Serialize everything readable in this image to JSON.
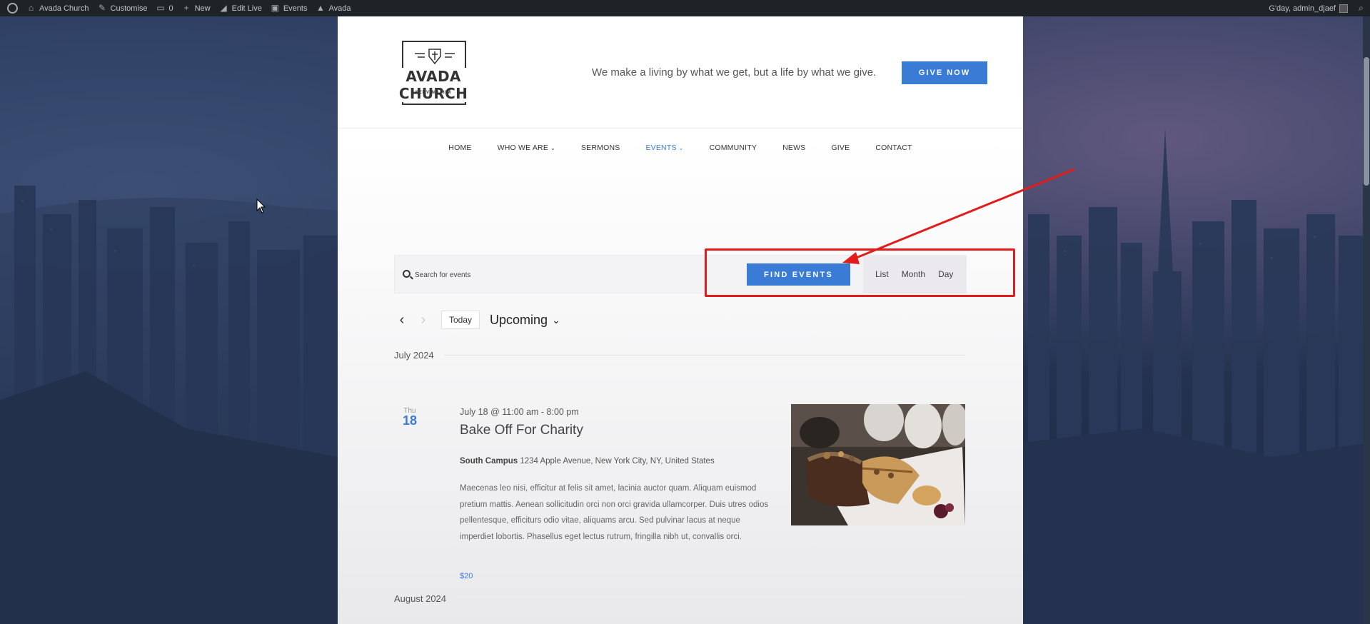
{
  "admin_bar": {
    "site_name": "Avada Church",
    "customise": "Customise",
    "comments_count": "0",
    "new": "New",
    "edit_live": "Edit Live",
    "events": "Events",
    "avada": "Avada",
    "greeting": "G'day, admin_djaef"
  },
  "header": {
    "logo_title": "AVADA CHURCH",
    "logo_subtitle": "SERVING HIM",
    "tagline": "We make a living by what we get, but a life by what we give.",
    "give_button": "GIVE NOW"
  },
  "nav": {
    "items": [
      {
        "label": "HOME"
      },
      {
        "label": "WHO WE ARE"
      },
      {
        "label": "SERMONS"
      },
      {
        "label": "EVENTS"
      },
      {
        "label": "COMMUNITY"
      },
      {
        "label": "NEWS"
      },
      {
        "label": "GIVE"
      },
      {
        "label": "CONTACT"
      }
    ],
    "active": "EVENTS"
  },
  "events_bar": {
    "search_placeholder": "Search for events",
    "find_button": "FIND EVENTS",
    "views": [
      "List",
      "Month",
      "Day"
    ]
  },
  "date_nav": {
    "today": "Today",
    "range": "Upcoming"
  },
  "months": [
    "July 2024",
    "August 2024"
  ],
  "event": {
    "dow": "Thu",
    "day": "18",
    "datetime": "July 18 @ 11:00 am - 8:00 pm",
    "title": "Bake Off For Charity",
    "venue_name": "South Campus",
    "venue_address": "1234 Apple Avenue, New York City, NY, United States",
    "description": "Maecenas leo nisi, efficitur at felis sit amet, lacinia auctor quam. Aliquam euismod pretium mattis. Aenean sollicitudin orci non orci gravida ullamcorper. Duis utres odios pellentesque, efficiturs odio vitae, aliquams arcu. Sed pulvinar lacus at neque imperdiet lobortis. Phasellus eget lectus rutrum, fringilla nibh ut, convallis orci.",
    "price": "$20"
  },
  "colors": {
    "accent": "#3a7bd5",
    "annotation": "#e21b1b",
    "admin_bar": "#1d2327"
  }
}
